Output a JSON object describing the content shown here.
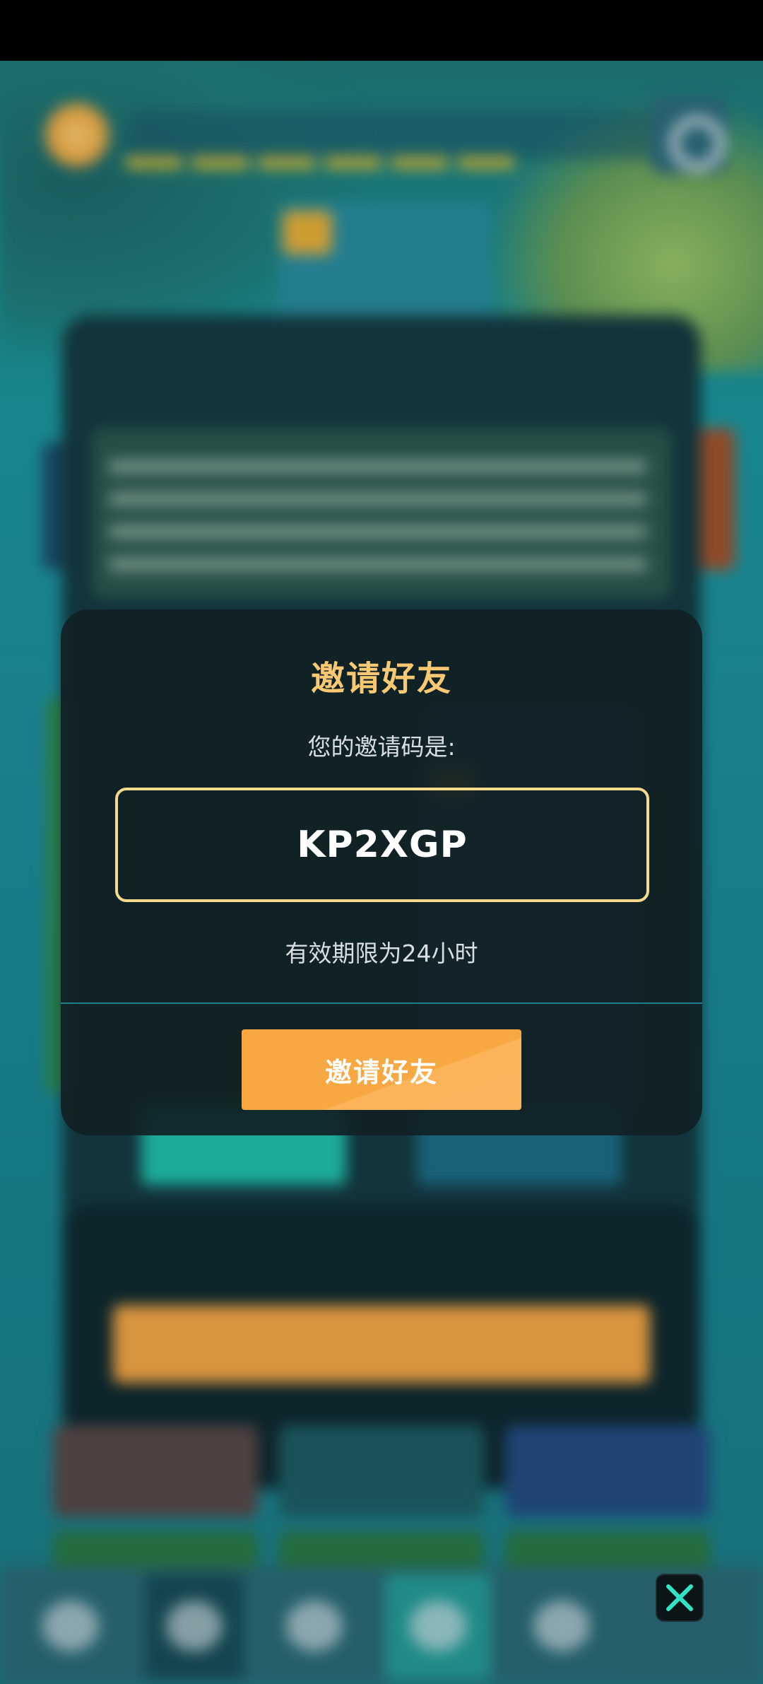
{
  "dialog": {
    "title": "邀请好友",
    "code_prompt": "您的邀请码是:",
    "invite_code": "KP2XGP",
    "expiry_note": "有效期限为24小时",
    "invite_button_label": "邀请好友"
  },
  "icons": {
    "close": "close-icon"
  },
  "colors": {
    "title": "#f8c872",
    "code_border": "#f5d98c",
    "button": "#f7a843",
    "dialog_bg": "#112126",
    "divider": "#1f7f8b"
  }
}
